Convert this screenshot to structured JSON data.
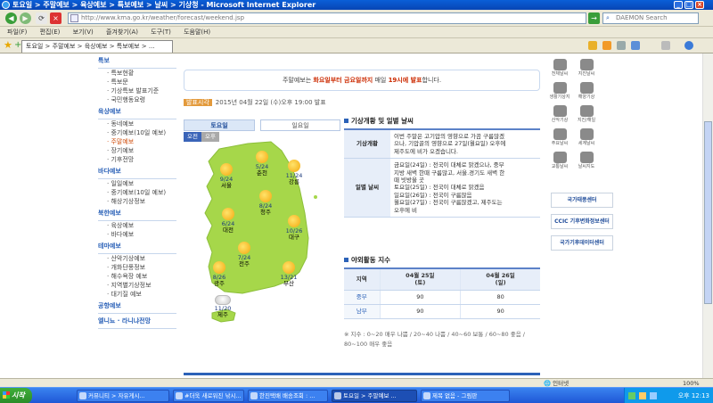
{
  "window": {
    "title": "토요일 > 주말예보 > 육상예보 > 특보예보 > 날씨 > 기상청 - Microsoft Internet Explorer",
    "address": "http://www.kma.go.kr/weather/forecast/weekend.jsp",
    "search_placeholder": "DAEMON Search"
  },
  "menu": [
    "파일(F)",
    "편집(E)",
    "보기(V)",
    "즐겨찾기(A)",
    "도구(T)",
    "도움말(H)"
  ],
  "tab": {
    "label": "토요일 > 주말예보 > 육상예보 > 특보예보 > ..."
  },
  "leftnav": {
    "sections": [
      {
        "title": "특보",
        "items": [
          "특보현황",
          "특보문",
          "기상특보 발표기준",
          "국민행동요령"
        ]
      },
      {
        "title": "육상예보",
        "items": [
          "동네예보",
          "중기예보(10일 예보)",
          "주말예보",
          "장기예보",
          "기후전망"
        ]
      },
      {
        "title": "바다예보",
        "items": [
          "일일예보",
          "중기예보(10일 예보)",
          "해상기상정보"
        ]
      },
      {
        "title": "북한예보",
        "items": [
          "육상예보",
          "바다예보"
        ]
      },
      {
        "title": "테마예보",
        "items": [
          "산악기상예보",
          "개화단풍정보",
          "해수욕장 예보",
          "지역별기상정보",
          "대기질 예보"
        ]
      },
      {
        "title": "공항예보",
        "items": []
      },
      {
        "title": "엘니뇨 · 라니냐전망",
        "items": []
      }
    ],
    "selected": "주말예보"
  },
  "notice": {
    "pre": "주말예보는 ",
    "emph1": "화요일부터 금요일까지",
    "mid": " 매일 ",
    "emph2": "19시에 발표",
    "post": "합니다."
  },
  "announce": {
    "label": "발표시각",
    "text": "2015년 04월 22일 (수)오후 19:00 발표"
  },
  "day_tabs": [
    "토요일",
    "일요일"
  ],
  "ampm": [
    "오전",
    "오후"
  ],
  "cities": [
    {
      "temp": "9/24",
      "name": "서울",
      "icon": "sun"
    },
    {
      "temp": "5/24",
      "name": "춘천",
      "icon": "sun"
    },
    {
      "temp": "11/24",
      "name": "강릉",
      "icon": "sun"
    },
    {
      "temp": "8/24",
      "name": "청주",
      "icon": "sun"
    },
    {
      "temp": "6/24",
      "name": "대전",
      "icon": "sun"
    },
    {
      "temp": "10/26",
      "name": "대구",
      "icon": "sun"
    },
    {
      "temp": "7/24",
      "name": "전주",
      "icon": "sun"
    },
    {
      "temp": "8/26",
      "name": "광주",
      "icon": "sun"
    },
    {
      "temp": "13/21",
      "name": "부산",
      "icon": "sun"
    },
    {
      "temp": "11/20",
      "name": "제주",
      "icon": "cloud"
    }
  ],
  "weather": {
    "title": "기상개황 및 일별 날씨",
    "rows": [
      {
        "header": "기상개황",
        "lines": [
          "이번 주말은 고기압의 영향으로 가끔 구름많겠",
          "으나, 기압골의 영향으로 27일(월요일) 오후에",
          "제주도에 비가 오겠습니다."
        ]
      },
      {
        "header": "일별 날씨",
        "lines": [
          "금요일(24일) : 전국이 대체로 맑겠으나, 중부",
          "지방 새벽 한때 구름많고, 서울.경기도 새벽 한",
          "때 빗방울 곳",
          "토요일(25일) : 전국이 대체로 맑겠음",
          "일요일(26일) : 전국이 구름많음",
          "월요일(27일) : 전국이 구름많겠고, 제주도는",
          "오후에 비"
        ]
      }
    ]
  },
  "outdoor": {
    "title": "야외활동 지수",
    "header_region": "지역",
    "header_day1": [
      "04월 25일",
      "(토)"
    ],
    "header_day2": [
      "04월 26일",
      "(일)"
    ],
    "rows": [
      {
        "region": "중부",
        "d1": "90",
        "d2": "80"
      },
      {
        "region": "남부",
        "d1": "90",
        "d2": "90"
      }
    ],
    "note1": "※ 지수 : 0~20 매우 나쁨 / 20~40 나쁨 / 40~60 보통 / 60~80 좋음 /",
    "note2": "80~100 매우 좋음"
  },
  "right_icons": [
    "천체날씨",
    "지진날씨",
    "생활기상지",
    "해양기상",
    "산악기상",
    "지진/해일",
    "주요날씨",
    "세계날씨",
    "교통날씨",
    "날씨지도"
  ],
  "banners": [
    "국가태풍센터",
    "CCIC 기후변화정보센터",
    "국가기후데이터센터"
  ],
  "status": {
    "zone": "인터넷",
    "zoom": "100%"
  },
  "taskbar": {
    "start": "시작",
    "tasks": [
      "커뮤니티 > 자유게시...",
      "#더욱 새로워진 낚시...",
      "한진택배 배송조회 : ...",
      "토요일 > 주말예보 ...",
      "제목 없음 - 그림판"
    ],
    "active_index": 3,
    "clock": "오후 12:13"
  }
}
